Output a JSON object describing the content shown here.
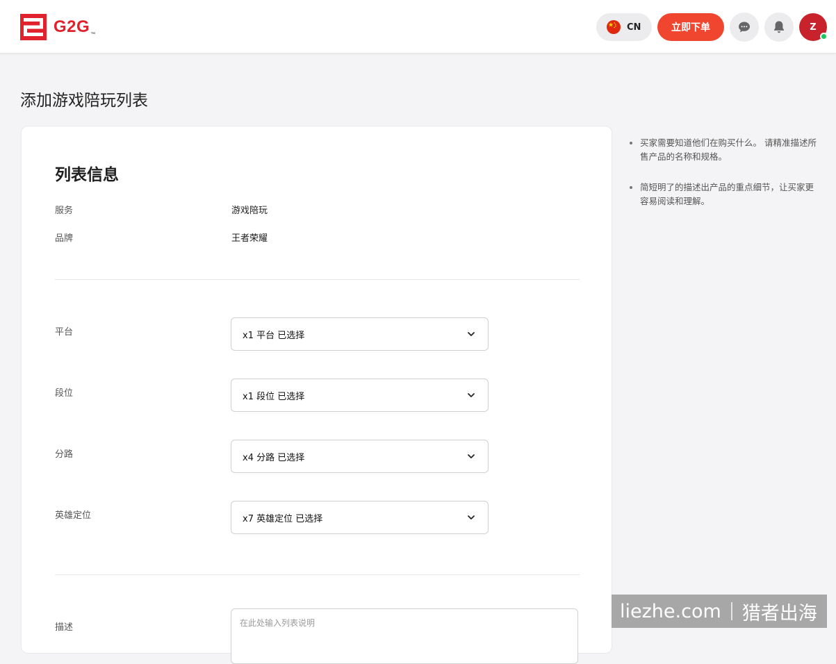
{
  "header": {
    "logo_text": "G2G",
    "logo_tm": "™",
    "language_code": "CN",
    "order_button_label": "立即下单",
    "avatar_initial": "Z",
    "icons": {
      "flag": "china-flag-icon",
      "messages": "chat-bubble-icon",
      "notifications": "bell-icon"
    }
  },
  "page": {
    "title": "添加游戏陪玩列表"
  },
  "listing_info": {
    "title": "列表信息",
    "rows": [
      {
        "label": "服务",
        "value": "游戏陪玩"
      },
      {
        "label": "品牌",
        "value": "王者荣耀"
      }
    ]
  },
  "attributes": [
    {
      "label": "平台",
      "selected": "x1 平台 已选择"
    },
    {
      "label": "段位",
      "selected": "x1 段位 已选择"
    },
    {
      "label": "分路",
      "selected": "x4 分路 已选择"
    },
    {
      "label": "英雄定位",
      "selected": "x7 英雄定位 已选择"
    }
  ],
  "description": {
    "label": "描述",
    "value": "",
    "placeholder": "在此处输入列表说明"
  },
  "tips": [
    "买家需要知道他们在购买什么。 请精准描述所售产品的名称和规格。",
    "简短明了的描述出产品的重点细节，让买家更容易阅读和理解。"
  ],
  "watermark": {
    "left": "liezhe.com",
    "right": "猎者出海"
  },
  "colors": {
    "brand_red": "#e1222c",
    "order_button": "#f0452e",
    "avatar_bg": "#c8232c",
    "online": "#21c45a"
  }
}
